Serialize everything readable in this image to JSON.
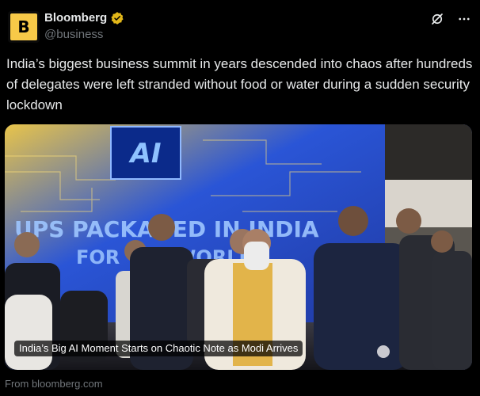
{
  "author": {
    "avatar_letter": "B",
    "display_name": "Bloomberg",
    "handle": "@business",
    "verified_color": "#e2b719"
  },
  "actions": {
    "grok_icon": "grok-icon",
    "more_icon": "more-icon"
  },
  "tweet": {
    "text": "India’s biggest business summit in years descended into chaos after hundreds of delegates were left stranded without food or water during a sudden security lockdown"
  },
  "card": {
    "banner_ai": "AI",
    "banner_line1": "UPS PACKAGED IN INDIA",
    "banner_line2": "FOR THE WORLD",
    "caption": "India’s Big AI Moment Starts on Chaotic Note as Modi Arrives",
    "source": "From bloomberg.com"
  },
  "colors": {
    "background": "#000000",
    "text": "#e7e9ea",
    "muted": "#71767b",
    "banner_blue": "#2a55d6",
    "avatar_yellow": "#f7c948"
  }
}
